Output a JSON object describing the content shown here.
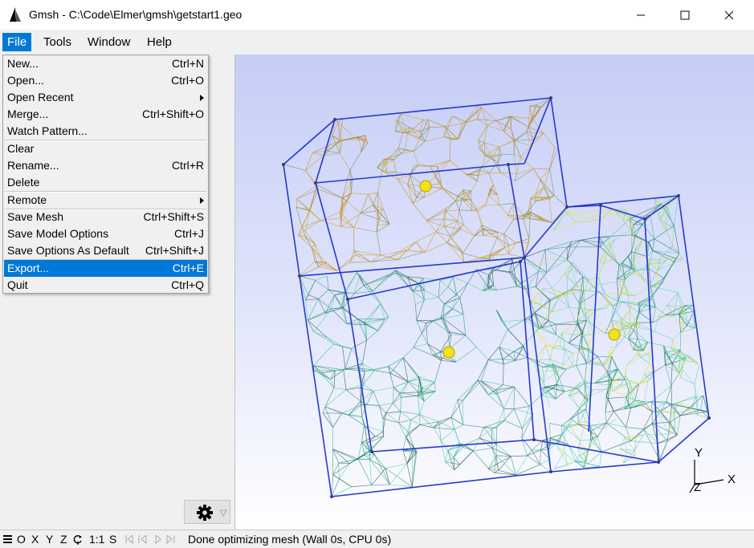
{
  "window": {
    "title": "Gmsh - C:\\Code\\Elmer\\gmsh\\getstart1.geo",
    "icon": "gmsh-logo-icon",
    "controls": [
      "minimize-icon",
      "maximize-icon",
      "close-icon"
    ]
  },
  "menubar": {
    "file": "File",
    "tools": "Tools",
    "window": "Window",
    "help": "Help"
  },
  "file_menu": {
    "new": {
      "label": "New...",
      "shortcut": "Ctrl+N"
    },
    "open": {
      "label": "Open...",
      "shortcut": "Ctrl+O"
    },
    "open_recent": {
      "label": "Open Recent"
    },
    "merge": {
      "label": "Merge...",
      "shortcut": "Ctrl+Shift+O"
    },
    "watch_pattern": {
      "label": "Watch Pattern..."
    },
    "clear": {
      "label": "Clear"
    },
    "rename": {
      "label": "Rename...",
      "shortcut": "Ctrl+R"
    },
    "delete": {
      "label": "Delete"
    },
    "remote": {
      "label": "Remote"
    },
    "save_mesh": {
      "label": "Save Mesh",
      "shortcut": "Ctrl+Shift+S"
    },
    "save_model_options": {
      "label": "Save Model Options",
      "shortcut": "Ctrl+J"
    },
    "save_options_default": {
      "label": "Save Options As Default",
      "shortcut": "Ctrl+Shift+J"
    },
    "export": {
      "label": "Export...",
      "shortcut": "Ctrl+E"
    },
    "quit": {
      "label": "Quit",
      "shortcut": "Ctrl+Q"
    }
  },
  "axes": {
    "x": "X",
    "y": "Y",
    "z": "Z"
  },
  "statusbar": {
    "menu_icon": "hamburger-icon",
    "o": "O",
    "x": "X",
    "y": "Y",
    "z": "Z",
    "rotate_icon": "rotate-icon",
    "scale": "1:1",
    "s": "S",
    "message": "Done optimizing mesh (Wall 0s, CPU 0s)"
  },
  "colors": {
    "accent": "#0078d7",
    "mesh_outline": "#1c2fd0",
    "mesh_orange": "#d79a1a",
    "mesh_green": "#2fae78",
    "mesh_lime": "#8ee04a",
    "mesh_yellow": "#f2e21a"
  }
}
